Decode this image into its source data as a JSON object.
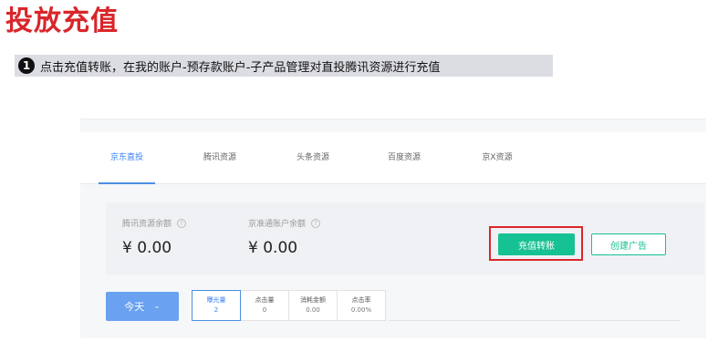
{
  "page_title": "投放充值",
  "step": {
    "number": "1",
    "text": "点击充值转账，在我的账户-预存款账户-子产品管理对直投腾讯资源进行充值"
  },
  "tabs": [
    {
      "label": "京东直投",
      "active": true
    },
    {
      "label": "腾讯资源",
      "active": false
    },
    {
      "label": "头条资源",
      "active": false
    },
    {
      "label": "百度资源",
      "active": false
    },
    {
      "label": "京X资源",
      "active": false
    }
  ],
  "balances": [
    {
      "label": "腾讯资源余额",
      "value": "¥ 0.00"
    },
    {
      "label": "京准通账户余额",
      "value": "¥ 0.00"
    }
  ],
  "help_glyph": "?",
  "buttons": {
    "recharge": "充值转账",
    "create_ad": "创建广告"
  },
  "date_filter": {
    "label": "今天",
    "icon": "chevron-down-icon"
  },
  "metrics": [
    {
      "label": "曝光量",
      "value": "2"
    },
    {
      "label": "点击量",
      "value": "0"
    },
    {
      "label": "消耗金额",
      "value": "0.00"
    },
    {
      "label": "点击率",
      "value": "0.00%"
    }
  ],
  "colors": {
    "title_red": "#d9262a",
    "accent_green": "#16c193",
    "accent_blue": "#4a90e2",
    "highlight_red": "#d9262a"
  }
}
